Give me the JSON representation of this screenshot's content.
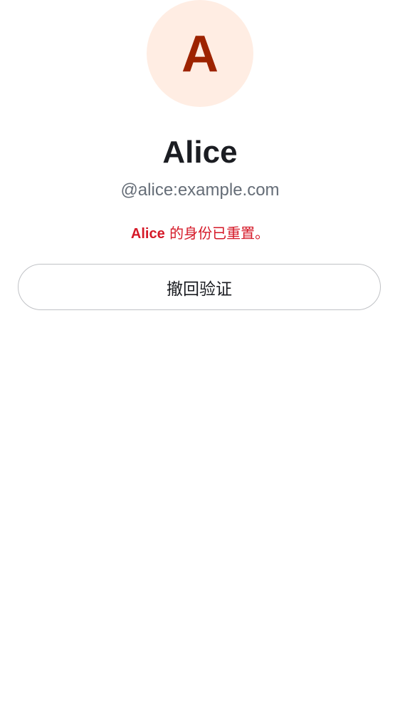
{
  "profile": {
    "avatar_initial": "A",
    "display_name": "Alice",
    "user_id": "@alice:example.com"
  },
  "notice": {
    "name": "Alice",
    "text": " 的身份已重置。"
  },
  "actions": {
    "withdraw_verification_label": "撤回验证"
  },
  "colors": {
    "avatar_bg": "#ffede3",
    "avatar_fg": "#9d2300",
    "critical": "#d51928",
    "secondary_text": "#656d77"
  }
}
